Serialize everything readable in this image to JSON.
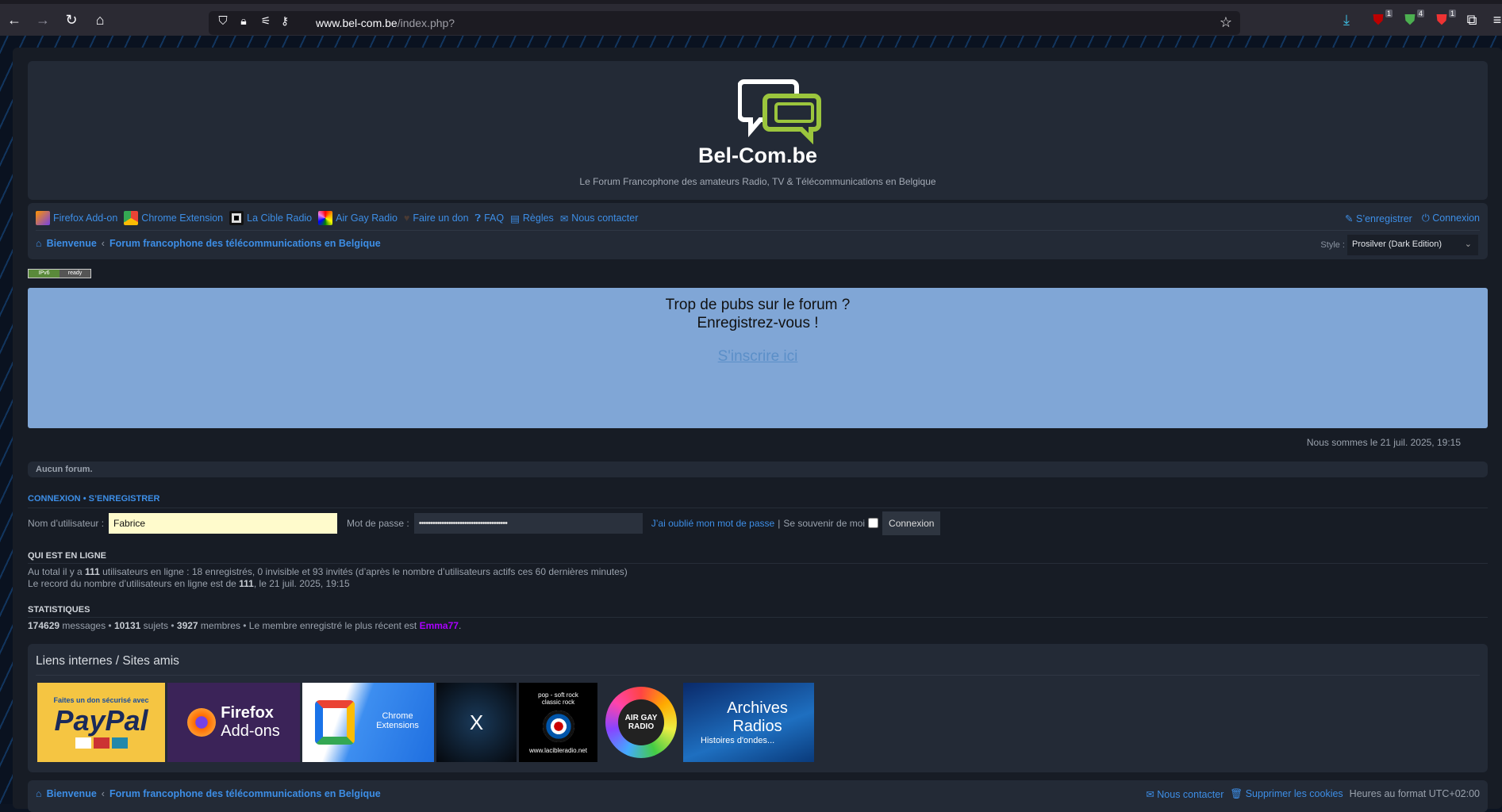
{
  "browser": {
    "url_domain": "www.bel-com.be",
    "url_path": "/index.php?",
    "ext_badges": [
      "1",
      "4",
      "1"
    ]
  },
  "header": {
    "site_name": "Bel-Com.be",
    "tagline": "Le Forum Francophone des amateurs Radio, TV & Télécommunications en Belgique"
  },
  "nav": {
    "links": [
      "Firefox Add-on",
      "Chrome Extension",
      "La Cible Radio",
      "Air Gay Radio",
      "Faire un don",
      "FAQ",
      "Règles",
      "Nous contacter"
    ],
    "register": "S’enregistrer",
    "login": "Connexion",
    "breadcrumb": [
      "Bienvenue",
      "Forum francophone des télécommunications en Belgique"
    ],
    "style_label": "Style :",
    "style_value": "Prosilver (Dark Edition)"
  },
  "ipv6": [
    "IPv6",
    "ready"
  ],
  "promo": {
    "line1": "Trop de pubs sur le forum ?",
    "line2": "Enregistrez-vous !",
    "link": "S'inscrire ici"
  },
  "datetime": "Nous sommes le 21 juil. 2025, 19:15",
  "no_forum": "Aucun forum.",
  "login": {
    "heading_login": "Connexion",
    "heading_register": "S’enregistrer",
    "username_label": "Nom d’utilisateur :",
    "username_value": "Fabrice",
    "password_label": "Mot de passe :",
    "password_value": "•••••••••••••••••••••••••••••••••••••••",
    "forgot": "J’ai oublié mon mot de passe",
    "remember": "Se souvenir de moi",
    "button": "Connexion"
  },
  "online": {
    "heading": "Qui est en ligne",
    "line1_pre": "Au total il y a ",
    "total": "111",
    "line1_post": " utilisateurs en ligne : 18 enregistrés, 0 invisible et 93 invités (d’après le nombre d’utilisateurs actifs ces 60 dernières minutes)",
    "line2_pre": "Le record du nombre d’utilisateurs en ligne est de ",
    "record": "111",
    "line2_post": ", le 21 juil. 2025, 19:15"
  },
  "stats": {
    "heading": "Statistiques",
    "messages": "174629",
    "messages_label": " messages • ",
    "topics": "10131",
    "topics_label": " sujets • ",
    "members": "3927",
    "members_label": " membres • Le membre enregistré le plus récent est ",
    "newest": "Emma77",
    "newest_color": "#aa00ff"
  },
  "links": {
    "title": "Liens internes / Sites amis",
    "banners": {
      "paypal_top": "Faites un don sécurisé avec",
      "paypal": "PayPal",
      "firefox": "Firefox",
      "firefox_sub": "Add-ons",
      "chrome": "Chrome Extensions",
      "x": "X",
      "cible_top": "pop - soft rock classic rock",
      "cible_url": "www.lacibleradio.net",
      "agr": "AIR GAY RADIO",
      "archives": "Archives Radios",
      "archives_sub": "Histoires d'ondes..."
    }
  },
  "footer": {
    "contact": "Nous contacter",
    "cookies": "Supprimer les cookies",
    "timezone": "Heures au format UTC+02:00"
  },
  "colors": {
    "link": "#3d8ee6",
    "promo_bg": "#80a6d6",
    "logo_green": "#9bc53d"
  }
}
